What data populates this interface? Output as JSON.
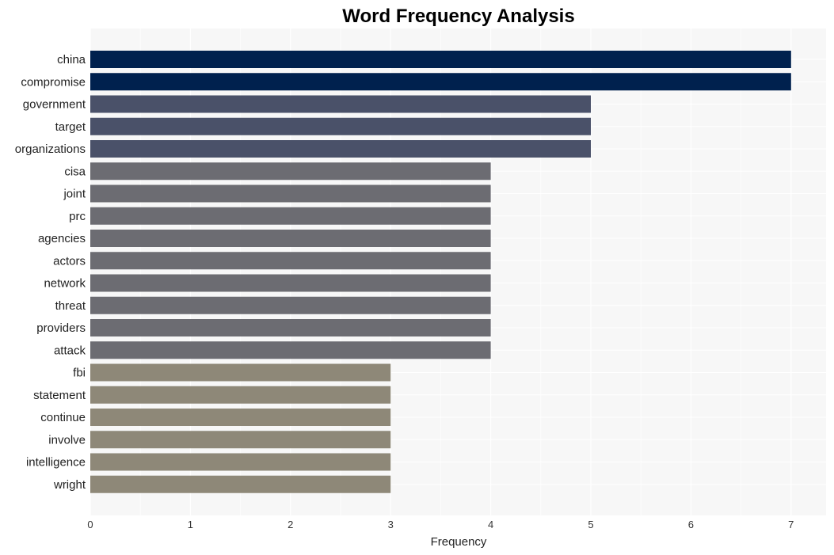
{
  "chart_data": {
    "type": "bar",
    "orientation": "horizontal",
    "title": "Word Frequency Analysis",
    "xlabel": "Frequency",
    "ylabel": "",
    "xlim": [
      0,
      7.35
    ],
    "xticks": [
      0,
      1,
      2,
      3,
      4,
      5,
      6,
      7
    ],
    "grid": true,
    "legend": "none",
    "categories": [
      "china",
      "compromise",
      "government",
      "target",
      "organizations",
      "cisa",
      "joint",
      "prc",
      "agencies",
      "actors",
      "network",
      "threat",
      "providers",
      "attack",
      "fbi",
      "statement",
      "continue",
      "involve",
      "intelligence",
      "wright"
    ],
    "values": [
      7,
      7,
      5,
      5,
      5,
      4,
      4,
      4,
      4,
      4,
      4,
      4,
      4,
      4,
      3,
      3,
      3,
      3,
      3,
      3
    ],
    "colors_by_value": {
      "7": "#00214e",
      "5": "#4a5169",
      "4": "#6c6c72",
      "3": "#8e8878"
    }
  },
  "colors": {
    "plot_background": "#f7f7f7",
    "grid": "#ffffff"
  }
}
